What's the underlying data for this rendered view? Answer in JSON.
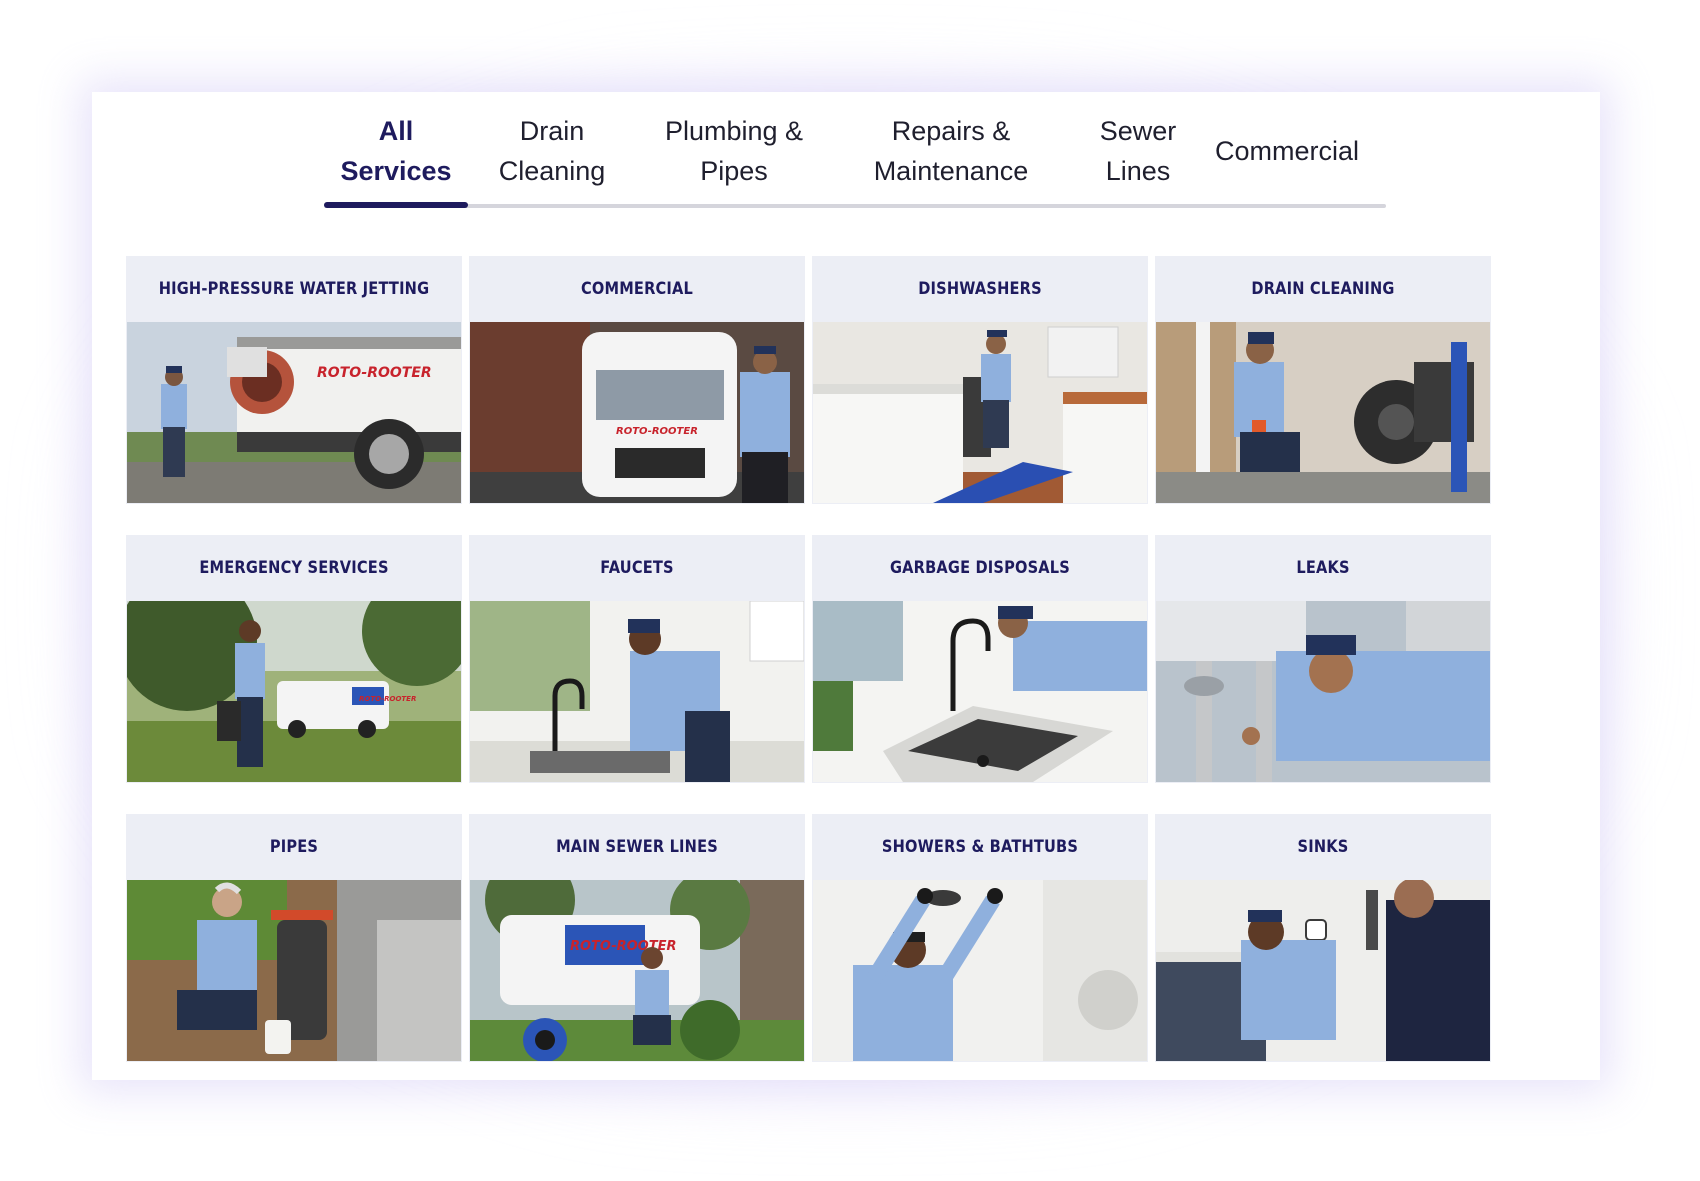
{
  "tabs": [
    {
      "line1": "All",
      "line2": "Services",
      "active": true
    },
    {
      "line1": "Drain",
      "line2": "Cleaning",
      "active": false
    },
    {
      "line1": "Plumbing &",
      "line2": "Pipes",
      "active": false
    },
    {
      "line1": "Repairs &",
      "line2": "Maintenance",
      "active": false
    },
    {
      "line1": "Sewer",
      "line2": "Lines",
      "active": false
    },
    {
      "line1": "Commercial",
      "line2": "",
      "active": false
    }
  ],
  "services": [
    {
      "title": "HIGH-PRESSURE WATER JETTING",
      "photo": "technician-water-jetter-truck",
      "brand_text": "ROTO-ROOTER"
    },
    {
      "title": "COMMERCIAL",
      "photo": "technician-service-van",
      "brand_text": "ROTO-ROOTER"
    },
    {
      "title": "DISHWASHERS",
      "photo": "technician-kitchen-dishwasher"
    },
    {
      "title": "DRAIN CLEANING",
      "photo": "technician-drain-machine"
    },
    {
      "title": "EMERGENCY SERVICES",
      "photo": "technician-yard-van",
      "brand_text": "ROTO-ROOTER"
    },
    {
      "title": "FAUCETS",
      "photo": "technician-kitchen-faucet"
    },
    {
      "title": "GARBAGE DISPOSALS",
      "photo": "technician-sink-disposal"
    },
    {
      "title": "LEAKS",
      "photo": "technician-under-sink"
    },
    {
      "title": "PIPES",
      "photo": "technician-outdoor-pipe"
    },
    {
      "title": "MAIN SEWER LINES",
      "photo": "technician-sewer-van",
      "brand_text": "ROTO-ROOTER"
    },
    {
      "title": "SHOWERS & BATHTUBS",
      "photo": "technician-shower-head"
    },
    {
      "title": "SINKS",
      "photo": "technician-bathroom-sink"
    }
  ],
  "colors": {
    "accent": "#1e1b5e",
    "card_bg": "#eceef5",
    "uniform": "#8fb0dd",
    "brand_red": "#c8232c"
  }
}
